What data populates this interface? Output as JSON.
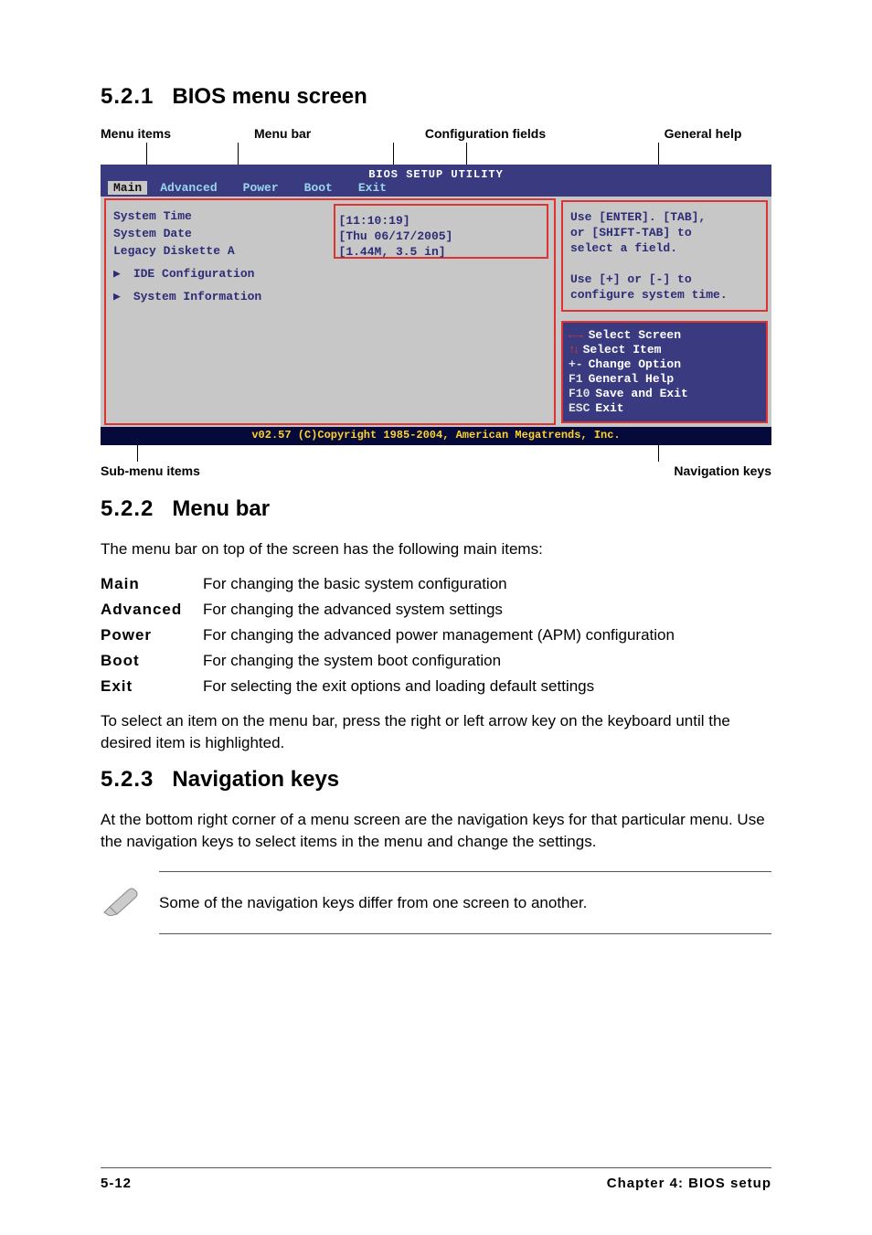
{
  "headings": {
    "h1_num": "5.2.1",
    "h1_txt": "BIOS menu screen",
    "h2_num": "5.2.2",
    "h2_txt": "Menu bar",
    "h3_num": "5.2.3",
    "h3_txt": "Navigation keys"
  },
  "callouts": {
    "c1": "Menu items",
    "c2": "Menu bar",
    "c3": "Configuration fields",
    "c4": "General help",
    "c5": "Sub-menu items",
    "c6": "Navigation keys"
  },
  "bios": {
    "title": "BIOS SETUP UTILITY",
    "tabs": [
      "Main",
      "Advanced",
      "Power",
      "Boot",
      "Exit"
    ],
    "fields": {
      "row1_label": "System Time",
      "row1_value": "[11:10:19]",
      "row2_label": "System Date",
      "row2_value": "[Thu 06/17/2005]",
      "row3_label": "Legacy Diskette A",
      "row3_value": "[1.44M, 3.5 in]",
      "sub1": "IDE Configuration",
      "sub2": "System Information"
    },
    "help": "Use [ENTER]. [TAB],\nor [SHIFT-TAB] to\nselect a field.\n\nUse [+] or [-] to\nconfigure system time.",
    "nav": {
      "k1": "Select Screen",
      "k2": "Select Item",
      "k3_key": "+-",
      "k3": "Change Option",
      "k4_key": "F1",
      "k4": "General Help",
      "k5_key": "F10",
      "k5": "Save and Exit",
      "k6_key": "ESC",
      "k6": "Exit"
    },
    "copyright": "v02.57 (C)Copyright 1985-2004, American Megatrends, Inc."
  },
  "para1": "The menu bar on top of the screen has the following main items:",
  "defs": [
    {
      "term": "Main",
      "desc": "For changing the basic system configuration"
    },
    {
      "term": "Advanced",
      "desc": "For changing the advanced system settings"
    },
    {
      "term": "Power",
      "desc": "For changing the advanced power management (APM) configuration"
    },
    {
      "term": "Boot",
      "desc": "For changing the system boot configuration"
    },
    {
      "term": "Exit",
      "desc": "For selecting the exit options and loading default settings"
    }
  ],
  "para2": "To select an item on the menu bar, press the right or left arrow key on the keyboard until the desired item is highlighted.",
  "para3": "At the bottom right corner of a menu screen are the navigation keys for that particular menu. Use the navigation keys to select items in the menu and change the settings.",
  "note": "Some of the navigation keys differ from one screen to another.",
  "footer": {
    "page": "5-12",
    "chapter": "Chapter 4: BIOS setup"
  }
}
